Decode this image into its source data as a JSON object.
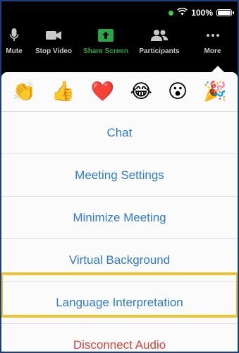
{
  "status": {
    "battery": "100%"
  },
  "toolbar": {
    "items": [
      {
        "label": "Mute"
      },
      {
        "label": "Stop Video"
      },
      {
        "label": "Share Screen"
      },
      {
        "label": "Participants"
      },
      {
        "label": "More"
      }
    ]
  },
  "reactions": [
    "👏",
    "👍",
    "❤️",
    "😂",
    "😮",
    "🎉"
  ],
  "menu": {
    "items": [
      {
        "label": "Chat"
      },
      {
        "label": "Meeting Settings"
      },
      {
        "label": "Minimize Meeting"
      },
      {
        "label": "Virtual Background"
      },
      {
        "label": "Language Interpretation"
      },
      {
        "label": "Disconnect Audio"
      }
    ]
  },
  "colors": {
    "accent": "#2e7bd3",
    "danger": "#d9443b",
    "share": "#27a845",
    "highlight": "#f1c232"
  }
}
